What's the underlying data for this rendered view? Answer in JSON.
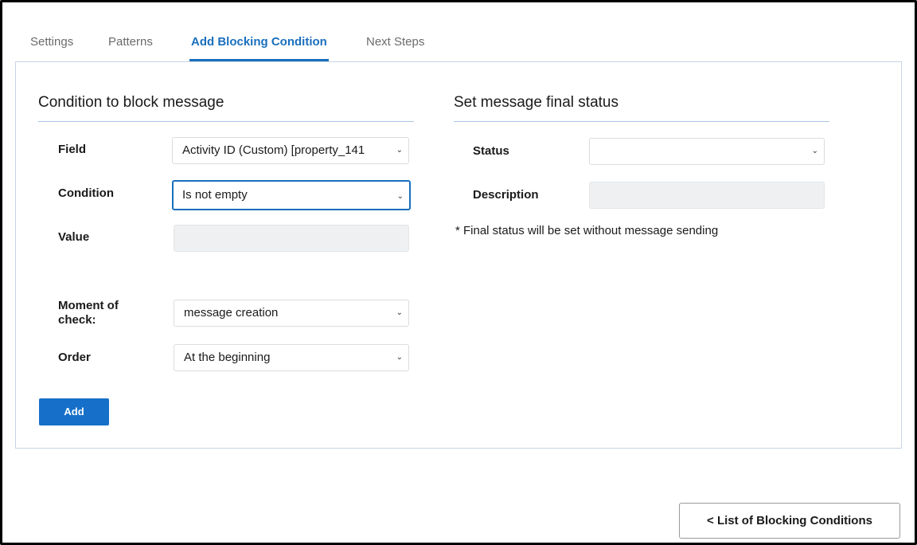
{
  "tabs": [
    {
      "label": "Settings"
    },
    {
      "label": "Patterns"
    },
    {
      "label": "Add Blocking Condition"
    },
    {
      "label": "Next Steps"
    }
  ],
  "active_tab": "Add Blocking Condition",
  "left_section": {
    "title": "Condition to block message",
    "field": {
      "label": "Field",
      "value": "Activity ID (Custom) [property_141"
    },
    "condition": {
      "label": "Condition",
      "value": "Is not empty"
    },
    "value": {
      "label": "Value",
      "value": ""
    },
    "moment": {
      "label_line1": "Moment of",
      "label_line2": "check:",
      "value": "message creation"
    },
    "order": {
      "label": "Order",
      "value": "At the beginning"
    },
    "add_button": "Add"
  },
  "right_section": {
    "title": "Set message final status",
    "status": {
      "label": "Status",
      "value": ""
    },
    "description": {
      "label": "Description",
      "value": ""
    },
    "note": "* Final status will be set without message sending"
  },
  "footer": {
    "back_button": "< List of Blocking Conditions"
  },
  "colors": {
    "accent": "#1a6fbd",
    "button_primary": "#1670c9",
    "panel_border": "#c7d4e3",
    "disabled_input": "#eef0f2"
  },
  "icons": {
    "select_arrow": "chevron-down-icon"
  }
}
